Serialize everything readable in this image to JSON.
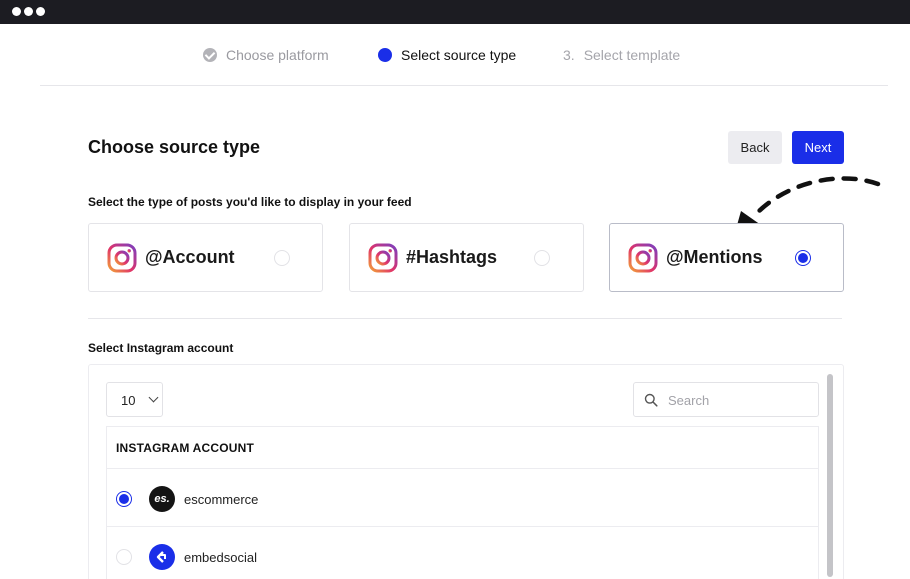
{
  "stepper": {
    "steps": [
      {
        "label": "Choose platform",
        "state": "done"
      },
      {
        "label": "Select source type",
        "state": "active"
      },
      {
        "number": "3.",
        "label": "Select template",
        "state": "upcoming"
      }
    ]
  },
  "header": {
    "title": "Choose source type",
    "back_label": "Back",
    "next_label": "Next"
  },
  "source_section": {
    "label": "Select the type of posts you'd like to display in your feed",
    "options": [
      {
        "label": "@Account",
        "icon": "instagram-icon",
        "selected": false
      },
      {
        "label": "#Hashtags",
        "icon": "instagram-icon",
        "selected": false
      },
      {
        "label": "@Mentions",
        "icon": "instagram-icon",
        "selected": true
      }
    ]
  },
  "account_section": {
    "label": "Select Instagram account",
    "page_size": "10",
    "search_placeholder": "Search",
    "column_header": "INSTAGRAM ACCOUNT",
    "rows": [
      {
        "name": "escommerce",
        "avatar_text": "es.",
        "selected": true
      },
      {
        "name": "embedsocial",
        "avatar_icon": "embedsocial-logo-icon",
        "selected": false
      }
    ]
  },
  "colors": {
    "accent": "#1a2ee8",
    "titlebar": "#1c1c22",
    "muted_text": "#9a9aa0"
  }
}
